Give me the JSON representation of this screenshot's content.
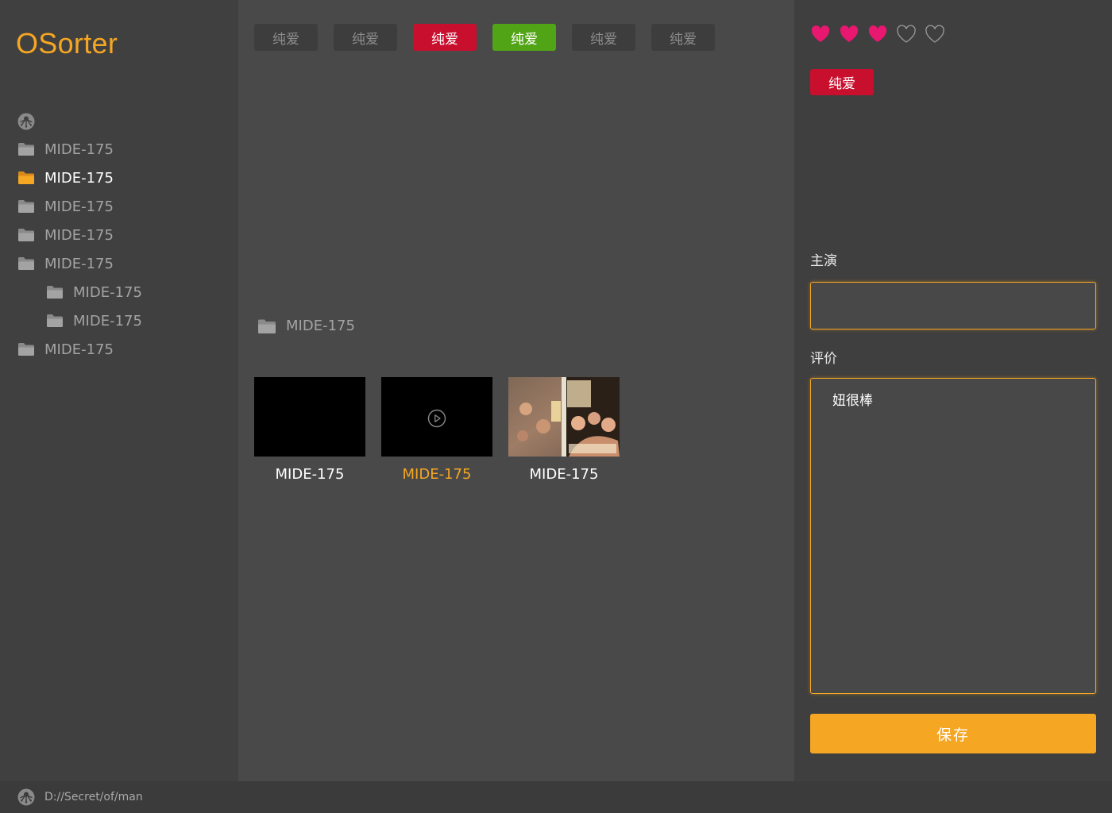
{
  "app": {
    "title": "OSorter"
  },
  "sidebar": {
    "items": [
      {
        "label": "MIDE-175",
        "depth": 0,
        "active": false
      },
      {
        "label": "MIDE-175",
        "depth": 0,
        "active": true
      },
      {
        "label": "MIDE-175",
        "depth": 0,
        "active": false
      },
      {
        "label": "MIDE-175",
        "depth": 0,
        "active": false
      },
      {
        "label": "MIDE-175",
        "depth": 0,
        "active": false
      },
      {
        "label": "MIDE-175",
        "depth": 1,
        "active": false
      },
      {
        "label": "MIDE-175",
        "depth": 1,
        "active": false
      },
      {
        "label": "MIDE-175",
        "depth": 0,
        "active": false
      }
    ]
  },
  "tagbar": {
    "tags": [
      {
        "label": "纯爱",
        "state": "default"
      },
      {
        "label": "纯爱",
        "state": "default"
      },
      {
        "label": "纯爱",
        "state": "red"
      },
      {
        "label": "纯爱",
        "state": "green"
      },
      {
        "label": "纯爱",
        "state": "default"
      },
      {
        "label": "纯爱",
        "state": "default"
      }
    ]
  },
  "main": {
    "folder": {
      "label": "MIDE-175"
    },
    "videos": [
      {
        "label": "MIDE-175",
        "thumb": "black",
        "selected": false
      },
      {
        "label": "MIDE-175",
        "thumb": "play",
        "selected": true
      },
      {
        "label": "MIDE-175",
        "thumb": "cover",
        "selected": false
      }
    ]
  },
  "panel": {
    "rating": {
      "value": 3,
      "max": 5
    },
    "tag": {
      "label": "纯爱"
    },
    "actor": {
      "label": "主演",
      "value": ""
    },
    "review": {
      "label": "评价",
      "value": "妞很棒"
    },
    "save": {
      "label": "保存"
    }
  },
  "statusbar": {
    "path": "D://Secret/of/man"
  },
  "colors": {
    "accent": "#f5a623",
    "tag_red": "#c8102e",
    "tag_green": "#52a417",
    "heart": "#e8176f"
  }
}
